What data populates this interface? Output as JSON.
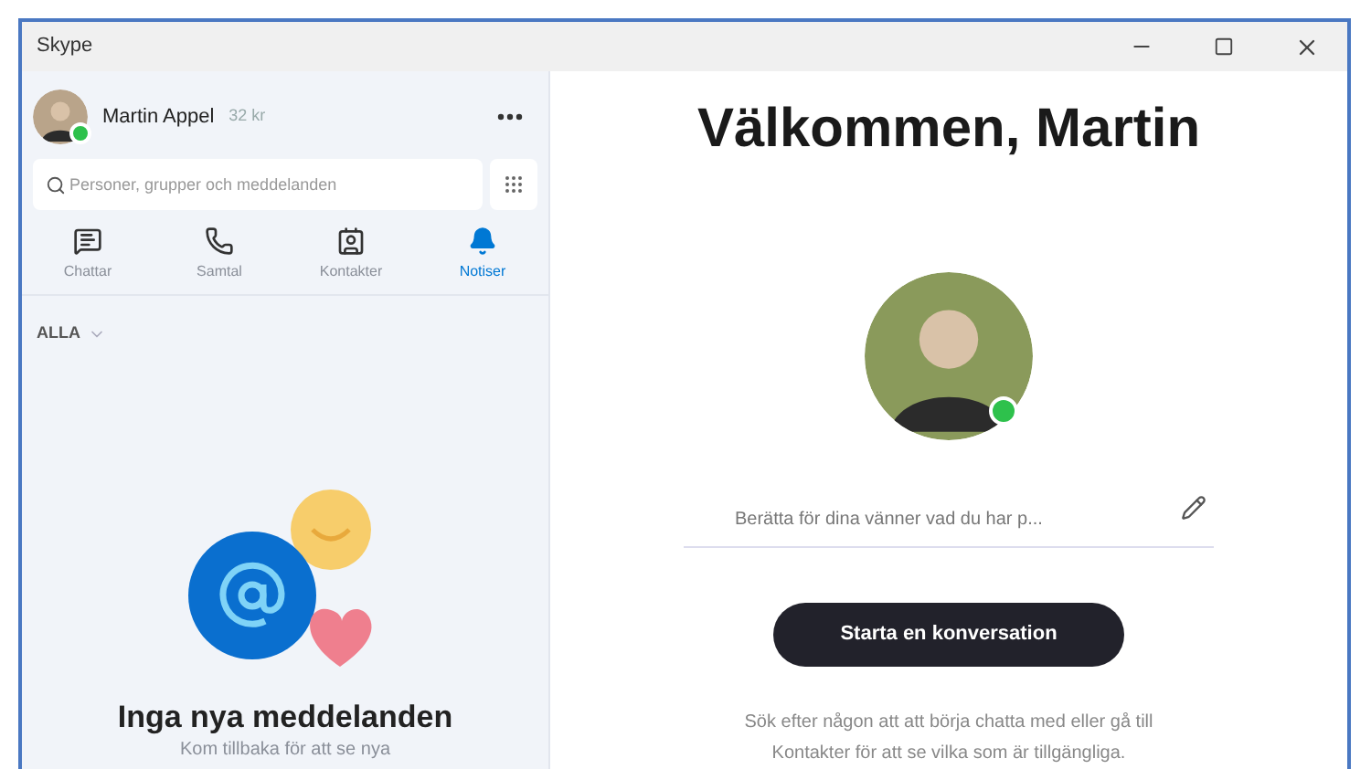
{
  "window": {
    "title": "Skype"
  },
  "profile": {
    "name": "Martin Appel",
    "credit": "32 kr",
    "online": true
  },
  "search": {
    "placeholder": "Personer, grupper och meddelanden"
  },
  "tabs": [
    {
      "label": "Chattar",
      "kind": "chat",
      "selected": false
    },
    {
      "label": "Samtal",
      "kind": "calls",
      "selected": false
    },
    {
      "label": "Kontakter",
      "kind": "contacts",
      "selected": false
    },
    {
      "label": "Notiser",
      "kind": "notifications",
      "selected": true
    }
  ],
  "filter": {
    "label": "ALLA"
  },
  "empty_state": {
    "title": "Inga nya meddelanden",
    "subtitle": "Kom tillbaka för att se nya"
  },
  "welcome": {
    "heading": "Välkommen, Martin",
    "online": true,
    "mood": {
      "placeholder": "Berätta för dina vänner vad du har p..."
    },
    "button": "Starta en konversation",
    "help": "Sök efter någon att att börja chatta med eller gå till Kontakter för att se vilka som är tillgängliga."
  }
}
